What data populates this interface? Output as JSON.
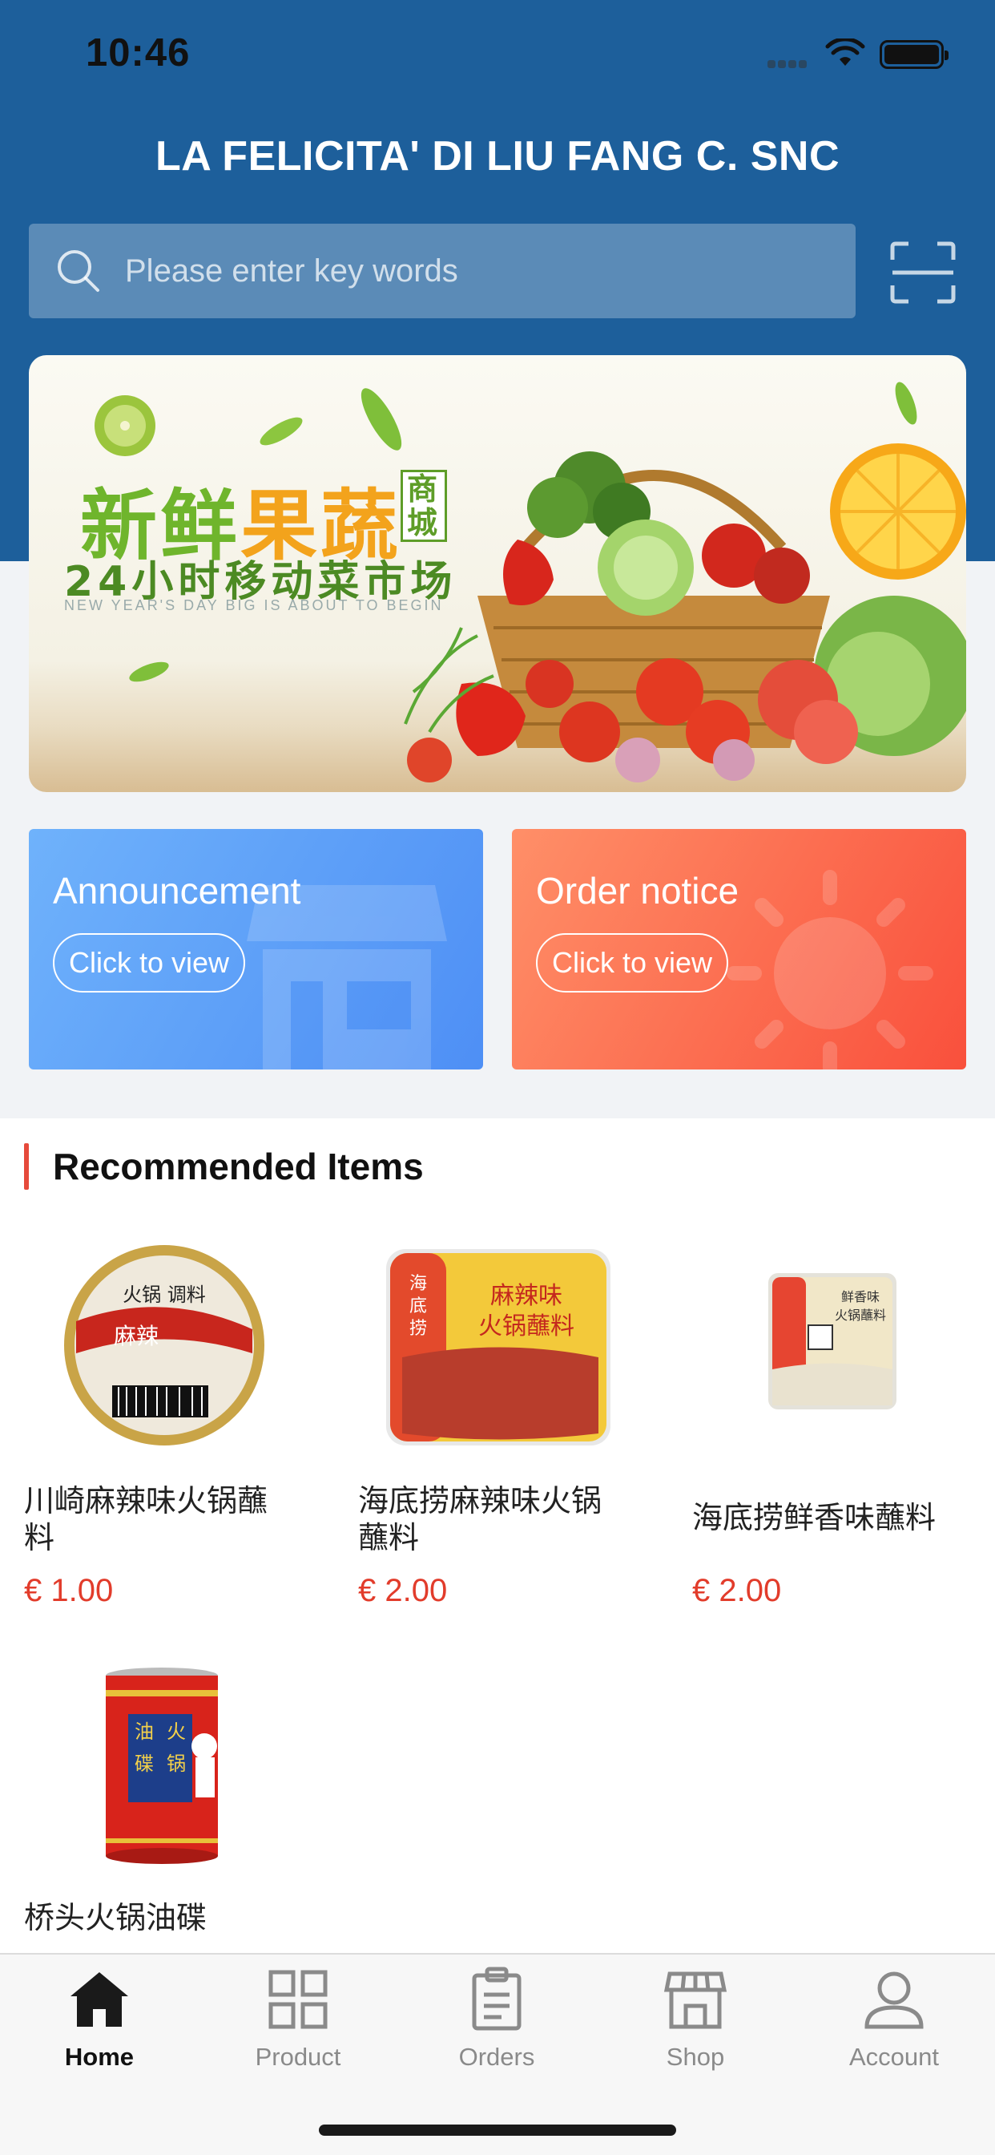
{
  "status_bar": {
    "time": "10:46"
  },
  "header": {
    "title": "LA FELICITA' DI LIU FANG C. SNC"
  },
  "search": {
    "placeholder": "Please enter key words"
  },
  "banner": {
    "line1_a": "新鲜",
    "line1_b": "果蔬",
    "line1_c": "商城",
    "line2": "24小时移动菜市场",
    "line3": "NEW YEAR'S DAY BIG IS ABOUT TO BEGIN"
  },
  "cards": [
    {
      "title": "Announcement",
      "button": "Click to view"
    },
    {
      "title": "Order notice",
      "button": "Click to view"
    }
  ],
  "recommended": {
    "heading": "Recommended Items",
    "items": [
      {
        "name": "川崎麻辣味火锅蘸料",
        "price": "€ 1.00",
        "image_text": "麻辣"
      },
      {
        "name": "海底捞麻辣味火锅蘸料",
        "price": "€ 2.00",
        "image_text": "麻辣味火锅蘸料"
      },
      {
        "name": "海底捞鲜香味蘸料",
        "price": "€ 2.00",
        "image_text": "鲜香味火锅蘸料"
      },
      {
        "name": "桥头火锅油碟",
        "price": "",
        "image_text": "油火碟锅"
      }
    ]
  },
  "tabbar": {
    "items": [
      {
        "label": "Home",
        "icon": "home-icon",
        "active": true
      },
      {
        "label": "Product",
        "icon": "grid-icon",
        "active": false
      },
      {
        "label": "Orders",
        "icon": "clipboard-icon",
        "active": false
      },
      {
        "label": "Shop",
        "icon": "store-icon",
        "active": false
      },
      {
        "label": "Account",
        "icon": "person-icon",
        "active": false
      }
    ]
  },
  "colors": {
    "header_blue": "#1d5f9b",
    "price_red": "#e23c2b",
    "accent_red": "#e64a3b"
  }
}
